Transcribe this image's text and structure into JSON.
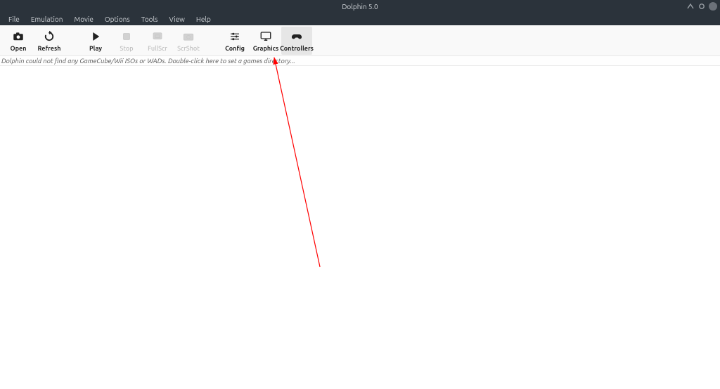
{
  "window": {
    "title": "Dolphin 5.0"
  },
  "menubar": {
    "items": [
      "File",
      "Emulation",
      "Movie",
      "Options",
      "Tools",
      "View",
      "Help"
    ]
  },
  "toolbar": {
    "open": {
      "label": "Open",
      "icon": "camera-icon",
      "enabled": true
    },
    "refresh": {
      "label": "Refresh",
      "icon": "refresh-icon",
      "enabled": true
    },
    "play": {
      "label": "Play",
      "icon": "play-icon",
      "enabled": true
    },
    "stop": {
      "label": "Stop",
      "icon": "stop-icon",
      "enabled": false
    },
    "fullscr": {
      "label": "FullScr",
      "icon": "fullscreen-icon",
      "enabled": false
    },
    "scrshot": {
      "label": "ScrShot",
      "icon": "screenshot-icon",
      "enabled": false
    },
    "config": {
      "label": "Config",
      "icon": "sliders-icon",
      "enabled": true
    },
    "graphics": {
      "label": "Graphics",
      "icon": "monitor-icon",
      "enabled": true
    },
    "controllers": {
      "label": "Controllers",
      "icon": "gamepad-icon",
      "enabled": true,
      "active": true
    }
  },
  "content": {
    "empty_message": "Dolphin could not find any GameCube/Wii ISOs or WADs. Double-click here to set a games directory..."
  },
  "annotation": {
    "arrow_color": "#ff0000"
  }
}
